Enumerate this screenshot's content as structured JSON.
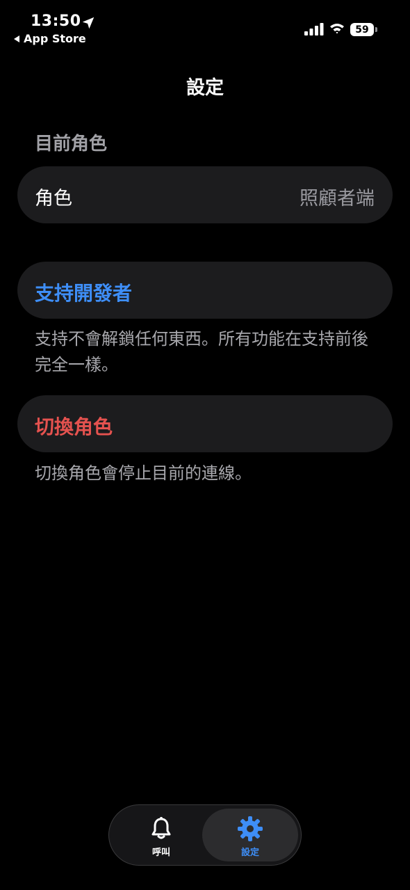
{
  "status_bar": {
    "time": "13:50",
    "back_app": "App Store",
    "battery": "59"
  },
  "nav": {
    "title": "設定"
  },
  "current_role_section": {
    "header": "目前角色",
    "row_label": "角色",
    "row_value": "照顧者端"
  },
  "support": {
    "button_label": "支持開發者",
    "note": "支持不會解鎖任何東西。所有功能在支持前後完全一樣。"
  },
  "switch_role": {
    "button_label": "切換角色",
    "note": "切換角色會停止目前的連線。"
  },
  "tab_bar": {
    "tabs": [
      {
        "label": "呼叫",
        "icon": "bell-icon"
      },
      {
        "label": "設定",
        "icon": "gear-icon"
      }
    ],
    "active_index": 1
  },
  "colors": {
    "accent_blue": "#3e8ef7",
    "destructive_red": "#e5524f",
    "card_bg": "#1c1c1e",
    "secondary_text": "#a1a1a6"
  }
}
